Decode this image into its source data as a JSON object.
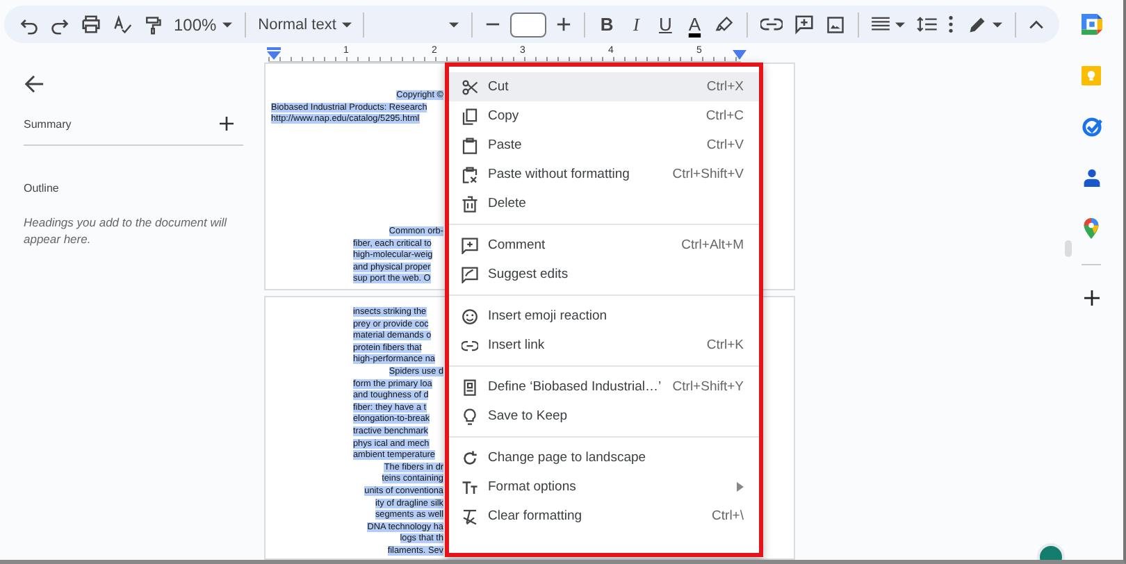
{
  "toolbar": {
    "zoom": "100%",
    "style": "Normal text",
    "format_buttons": [
      {
        "label": "B",
        "kind": "bold"
      },
      {
        "label": "I",
        "kind": "italic"
      },
      {
        "label": "U",
        "kind": "underline"
      },
      {
        "label": "A",
        "kind": "color"
      }
    ]
  },
  "ruler": {
    "numbers": [
      "1",
      "2",
      "3",
      "4",
      "5"
    ]
  },
  "outline_panel": {
    "summary": "Summary",
    "outline": "Outline",
    "hint": "Headings you add to the document will appear here."
  },
  "pages": [
    {
      "header_lines": [
        {
          "text": "Copyright ©",
          "kind": "right",
          "selected": true
        },
        {
          "text": "Biobased Industrial Products: Research",
          "kind": "wide",
          "selected": true
        },
        {
          "text": "http://www.nap.edu/catalog/5295.html",
          "kind": "wide",
          "selected": true
        }
      ],
      "body_lines": [
        {
          "text": "Common orb-",
          "kind": "right",
          "selected": true
        },
        {
          "text": "fiber, each critical to",
          "kind": "left",
          "selected": true
        },
        {
          "text": "high-molecular-weig",
          "kind": "left",
          "selected": true
        },
        {
          "text": "and physical proper",
          "kind": "left",
          "selected": true
        },
        {
          "text": "sup port the web. O",
          "kind": "left",
          "selected": true
        }
      ]
    },
    {
      "body_lines": [
        {
          "text": "insects striking the",
          "kind": "left",
          "selected": true
        },
        {
          "text": "prey or provide coc",
          "kind": "left",
          "selected": true
        },
        {
          "text": "material demands o",
          "kind": "left",
          "selected": true
        },
        {
          "text": "protein fibers that",
          "kind": "left",
          "selected": true
        },
        {
          "text": "high-performance na",
          "kind": "left",
          "selected": true
        },
        {
          "text": "Spiders use d",
          "kind": "right",
          "selected": true
        },
        {
          "text": "form the primary loa",
          "kind": "left",
          "selected": true
        },
        {
          "text": "and toughness of d",
          "kind": "left",
          "selected": true
        },
        {
          "text": "fiber: they have a t",
          "kind": "left",
          "selected": true
        },
        {
          "text": "elongation-to-break",
          "kind": "left",
          "selected": true
        },
        {
          "text": "tractive benchmark",
          "kind": "left",
          "selected": true
        },
        {
          "text": "phys ical and mech",
          "kind": "left",
          "selected": true
        },
        {
          "text": "ambient temperature",
          "kind": "left",
          "selected": true
        },
        {
          "text": "The fibers in dr",
          "kind": "right",
          "selected": true
        },
        {
          "text": "teins containing",
          "kind": "right",
          "selected": true
        },
        {
          "text": "units of conventiona",
          "kind": "right",
          "selected": true
        },
        {
          "text": "ity of dragline silk",
          "kind": "right",
          "selected": true
        },
        {
          "text": "segments as well",
          "kind": "right",
          "selected": true
        },
        {
          "text": "DNA technology ha",
          "kind": "right",
          "selected": true
        },
        {
          "text": "logs that th",
          "kind": "right",
          "selected": true
        },
        {
          "text": "filaments. Sev",
          "kind": "right",
          "selected": true
        }
      ]
    }
  ],
  "context_menu": {
    "groups": [
      [
        {
          "label": "Cut",
          "shortcut": "Ctrl+X",
          "kind": "command",
          "selected": true
        },
        {
          "label": "Copy",
          "shortcut": "Ctrl+C",
          "kind": "command",
          "selected": false
        },
        {
          "label": "Paste",
          "shortcut": "Ctrl+V",
          "kind": "command",
          "selected": false
        },
        {
          "label": "Paste without formatting",
          "shortcut": "Ctrl+Shift+V",
          "kind": "command",
          "selected": false
        },
        {
          "label": "Delete",
          "kind": "command",
          "selected": false
        }
      ],
      [
        {
          "label": "Comment",
          "shortcut": "Ctrl+Alt+M",
          "kind": "command",
          "selected": false
        },
        {
          "label": "Suggest edits",
          "kind": "command",
          "selected": false
        }
      ],
      [
        {
          "label": "Insert emoji reaction",
          "kind": "command",
          "selected": false
        },
        {
          "label": "Insert link",
          "shortcut": "Ctrl+K",
          "kind": "command",
          "selected": false
        }
      ],
      [
        {
          "label": "Define ‘Biobased Industrial…’",
          "shortcut": "Ctrl+Shift+Y",
          "kind": "command",
          "selected": false
        },
        {
          "label": "Save to Keep",
          "kind": "command",
          "selected": false
        }
      ],
      [
        {
          "label": "Change page to landscape",
          "kind": "command",
          "selected": false
        },
        {
          "label": "Format options",
          "kind": "submenu",
          "selected": false
        },
        {
          "label": "Clear formatting",
          "shortcut": "Ctrl+\\",
          "kind": "command",
          "selected": false
        }
      ]
    ]
  }
}
